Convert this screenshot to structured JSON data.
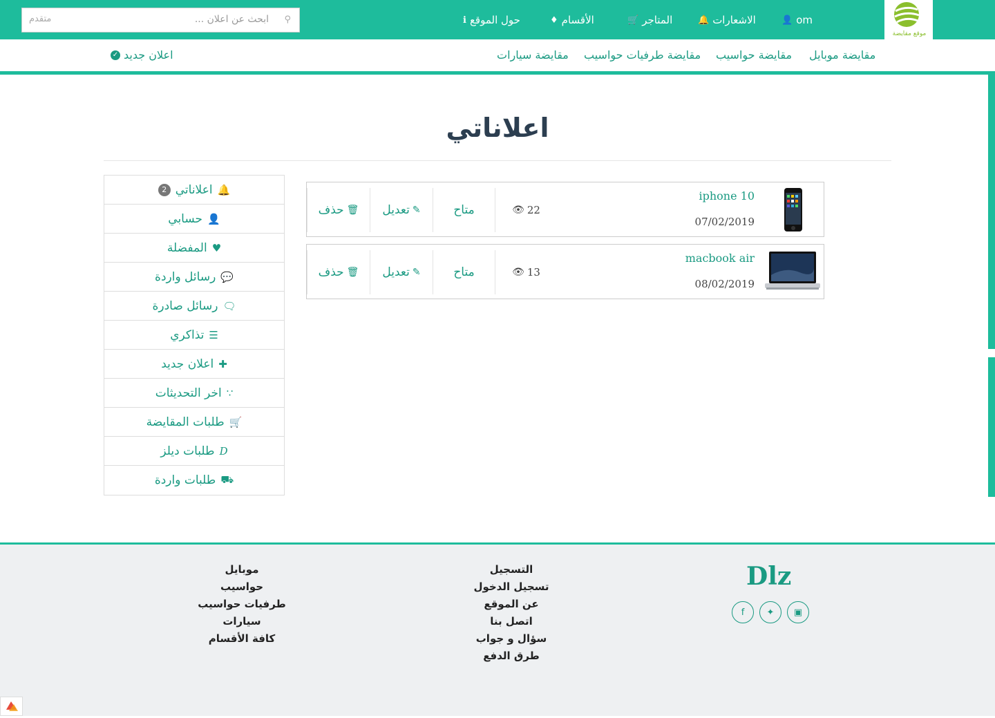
{
  "header": {
    "logo_text": "موقع مقايضة",
    "nav": [
      {
        "label": "om",
        "icon": "user-icon"
      },
      {
        "label": "الاشعارات",
        "icon": "bell-icon"
      },
      {
        "label": "المتاجر",
        "icon": "cart-icon"
      },
      {
        "label": "الأقسام",
        "icon": "tags-icon"
      },
      {
        "label": "حول الموقع",
        "icon": "info-icon"
      }
    ],
    "search": {
      "placeholder": "ابحث عن اعلان ...",
      "advanced_label": "متقدم"
    }
  },
  "subnav": {
    "links": [
      "مقايضة موبايل",
      "مقايضة حواسيب",
      "مقايضة طرفيات حواسيب",
      "مقايضة سيارات"
    ],
    "new_ad": "اعلان جديد"
  },
  "page_title": "اعلاناتي",
  "sidebar": {
    "items": [
      {
        "label": "اعلاناتي",
        "icon": "bell-icon",
        "badge": "2"
      },
      {
        "label": "حسابي",
        "icon": "user-icon"
      },
      {
        "label": "المفضلة",
        "icon": "heart-icon"
      },
      {
        "label": "رسائل واردة",
        "icon": "comments-icon"
      },
      {
        "label": "رسائل صادرة",
        "icon": "comments-outline-icon"
      },
      {
        "label": "تذاكري",
        "icon": "tasks-icon"
      },
      {
        "label": "اعلان جديد",
        "icon": "plus-icon"
      },
      {
        "label": "اخر التحديثات",
        "icon": "spinner-icon"
      },
      {
        "label": "طلبات المقايضة",
        "icon": "basket-icon"
      },
      {
        "label": "طلبات ديلز",
        "icon": "d-letter-icon",
        "icon_text": "D"
      },
      {
        "label": "طلبات واردة",
        "icon": "truck-icon"
      }
    ]
  },
  "ads": [
    {
      "name": "iphone 10",
      "date": "07/02/2019",
      "views": "22",
      "status": "متاح",
      "edit": "تعديل",
      "delete": "حذف",
      "thumb": "phone"
    },
    {
      "name": "macbook air",
      "date": "08/02/2019",
      "views": "13",
      "status": "متاح",
      "edit": "تعديل",
      "delete": "حذف",
      "thumb": "laptop"
    }
  ],
  "footer": {
    "brand": "Dlz",
    "col_account": [
      "التسجيل",
      "تسجيل الدخول",
      "عن الموقع",
      "اتصل بنا",
      "سؤال و جواب",
      "طرق الدفع"
    ],
    "col_categories": [
      "موبايل",
      "حواسيب",
      "طرفيات حواسيب",
      "سيارات",
      "كافة الأقسام"
    ],
    "social": [
      "facebook-icon",
      "twitter-icon",
      "instagram-icon"
    ]
  },
  "colors": {
    "brand": "#1ebc9c",
    "link": "#1a9a82",
    "title": "#2c3e50"
  }
}
